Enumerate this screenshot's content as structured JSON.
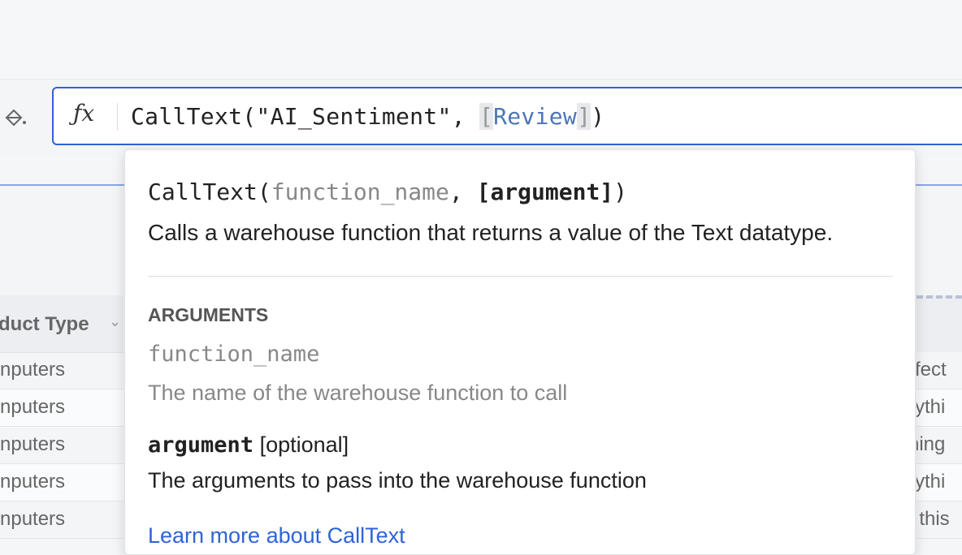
{
  "formula": {
    "fx_label": "ƒx",
    "text_prefix": "CallText(\"AI_Sentiment\", ",
    "open_bracket": "[",
    "column": "Review",
    "close_bracket": "]",
    "text_suffix": ")"
  },
  "table": {
    "left_column_header": "duct Type",
    "left_rows": [
      "nputers",
      "nputers",
      "nputers",
      "nputers",
      "nputers"
    ],
    "right_rows": [
      "rfect",
      "rythi",
      "ning",
      "rythi",
      "f this"
    ]
  },
  "popup": {
    "signature": {
      "function": "CallText(",
      "param1": "function_name",
      "comma": ", ",
      "param2": "[argument]",
      "close": ")"
    },
    "description": "Calls a warehouse function that returns a value of the Text datatype.",
    "arguments_heading": "ARGUMENTS",
    "arguments": [
      {
        "name": "function_name",
        "description": "The name of the warehouse function to call"
      },
      {
        "name": "argument",
        "optional_label": "[optional]",
        "description": "The arguments to pass into the warehouse function"
      }
    ],
    "learn_more": "Learn more about CallText"
  },
  "colors": {
    "accent": "#2f63d6",
    "column_ref": "#4c76b5"
  },
  "icons": {
    "fill": "paint-bucket-icon",
    "formula": "fx-icon",
    "dropdown": "chevron-down-icon"
  }
}
